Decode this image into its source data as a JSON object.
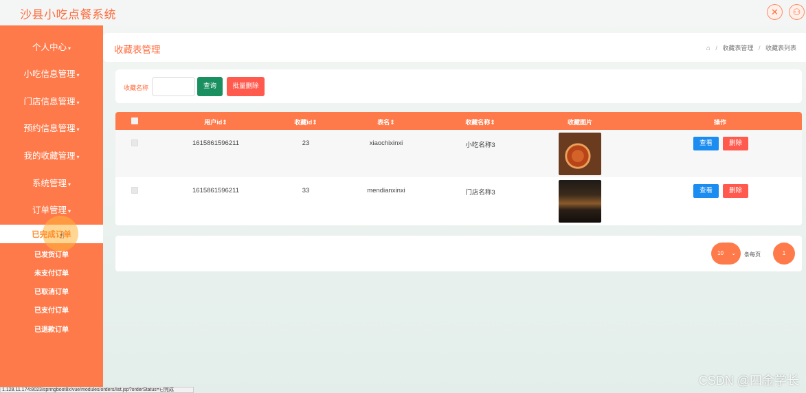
{
  "app": {
    "title": "沙县小吃点餐系统"
  },
  "header_icons": {
    "fullscreen": "fullscreen-icon",
    "user": "user-icon"
  },
  "sidebar": {
    "items": [
      {
        "label": "个人中心"
      },
      {
        "label": "小吃信息管理"
      },
      {
        "label": "门店信息管理"
      },
      {
        "label": "预约信息管理"
      },
      {
        "label": "我的收藏管理"
      },
      {
        "label": "系统管理"
      },
      {
        "label": "订单管理"
      }
    ],
    "orders_submenu": [
      {
        "label": "已完成订单",
        "active": true
      },
      {
        "label": "已发货订单"
      },
      {
        "label": "未支付订单"
      },
      {
        "label": "已取消订单"
      },
      {
        "label": "已支付订单"
      },
      {
        "label": "已退款订单"
      }
    ]
  },
  "page": {
    "title": "收藏表管理",
    "breadcrumb": [
      "收藏表管理",
      "收藏表列表"
    ]
  },
  "search": {
    "label": "收藏名称",
    "value": "",
    "query_button": "查询",
    "batch_delete_button": "批量删除"
  },
  "table": {
    "columns": [
      "用户id",
      "收藏id",
      "表名",
      "收藏名称",
      "收藏图片",
      "操作"
    ],
    "rows": [
      {
        "user_id": "1615861596211",
        "fav_id": "23",
        "table_name": "xiaochixinxi",
        "fav_name": "小吃名称3",
        "image": "food"
      },
      {
        "user_id": "1615861596211",
        "fav_id": "33",
        "table_name": "mendianxinxi",
        "fav_name": "门店名称3",
        "image": "store"
      }
    ],
    "view_label": "查看",
    "delete_label": "删除"
  },
  "pagination": {
    "page_size": "10",
    "per_page_label": "条每页",
    "current_page": "1"
  },
  "status_bar": {
    "url": "1.128.11.174:8023/springboot8x/vue/modules/orders/list.jsp?orderStatus=已完成"
  },
  "watermark": "CSDN @四金学长",
  "colors": {
    "accent": "#ff7a4a",
    "primary_green": "#1a8f5f",
    "danger": "#ff5a4d",
    "info": "#1b8cf0"
  }
}
